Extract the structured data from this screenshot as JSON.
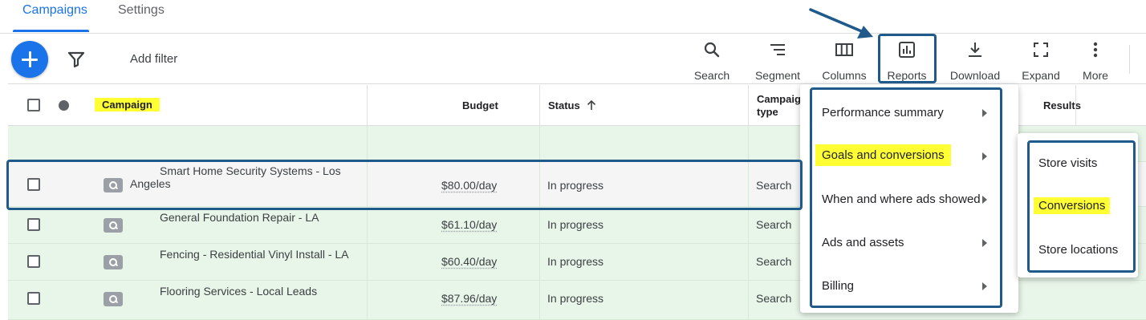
{
  "tabs": {
    "campaigns": "Campaigns",
    "settings": "Settings"
  },
  "toolbar": {
    "add_filter": "Add filter",
    "search": "Search",
    "segment": "Segment",
    "columns": "Columns",
    "reports": "Reports",
    "download": "Download",
    "expand": "Expand",
    "more": "More"
  },
  "table": {
    "headers": {
      "campaign": "Campaign",
      "budget": "Budget",
      "status": "Status",
      "campaign_type_line1": "Campaig",
      "campaign_type_line2": "type",
      "results": "Results"
    },
    "rows": [
      {
        "campaign_line1": "Smart Home Security Systems - Los",
        "campaign_line2": "Angeles",
        "budget": "$80.00/day",
        "status": "In progress",
        "type": "Search"
      },
      {
        "campaign_line1": "General Foundation Repair - LA",
        "campaign_line2": "",
        "budget": "$61.10/day",
        "status": "In progress",
        "type": "Search"
      },
      {
        "campaign_line1": "Fencing - Residential Vinyl Install - LA",
        "campaign_line2": "",
        "budget": "$60.40/day",
        "status": "In progress",
        "type": "Search"
      },
      {
        "campaign_line1": "Flooring Services - Local Leads",
        "campaign_line2": "",
        "budget": "$87.96/day",
        "status": "In progress",
        "type": "Search"
      }
    ]
  },
  "reports_menu": {
    "items": [
      "Performance summary",
      "Goals and conversions",
      "When and where ads showed",
      "Ads and assets",
      "Billing"
    ]
  },
  "submenu": {
    "items": [
      "Store visits",
      "Conversions",
      "Store locations"
    ]
  },
  "colors": {
    "accent": "#1a73e8",
    "highlight": "#ffff33",
    "annotation": "#1f5a8a",
    "row_bg": "#e8f5e9"
  }
}
